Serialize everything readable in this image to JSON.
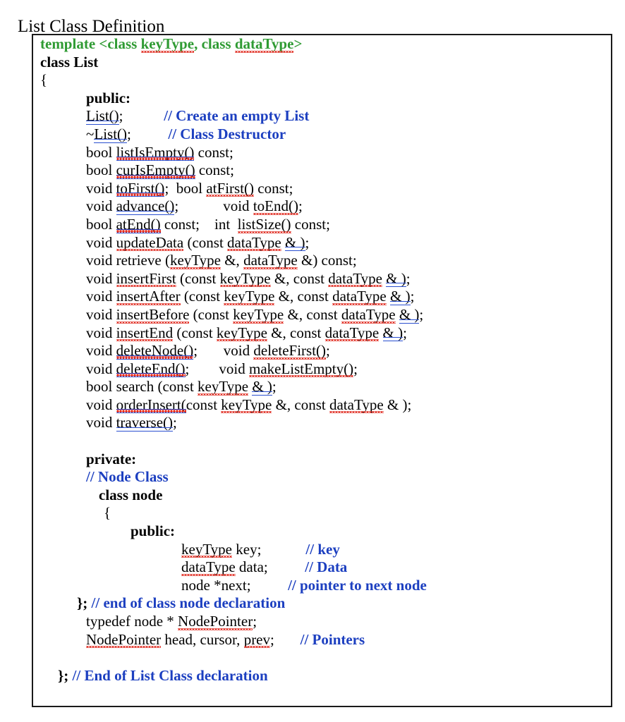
{
  "page": {
    "title": "List Class Definition",
    "colors": {
      "text": "#000000",
      "keyword_green": "#2f9b33",
      "comment_blue": "#1c3fc0",
      "spelling_squiggle_red": "#e02b20",
      "grammar_underline_blue": "#2a4fd0",
      "box_border": "#1a1a1a",
      "background": "#ffffff"
    }
  },
  "code": {
    "language": "C++",
    "lines": [
      {
        "indent": 10,
        "segs": [
          {
            "text": "template <class ",
            "style": "green"
          },
          {
            "text": "keyType",
            "style": "green",
            "mark": "spell"
          },
          {
            "text": ", class ",
            "style": "green"
          },
          {
            "text": "dataType",
            "style": "green",
            "mark": "spell"
          },
          {
            "text": ">",
            "style": "green"
          }
        ]
      },
      {
        "indent": 10,
        "segs": [
          {
            "text": "class List",
            "style": "bold"
          }
        ]
      },
      {
        "indent": 10,
        "segs": [
          {
            "text": "{",
            "style": "plain"
          }
        ]
      },
      {
        "indent": 75,
        "segs": [
          {
            "text": "public:",
            "style": "bold"
          }
        ]
      },
      {
        "indent": 75,
        "segs": [
          {
            "text": "List()",
            "style": "plain",
            "mark": "grammar"
          },
          {
            "text": ";",
            "style": "plain"
          },
          {
            "text": "           ",
            "style": "plain"
          },
          {
            "text": "// Create an empty List",
            "style": "comment"
          }
        ]
      },
      {
        "indent": 75,
        "segs": [
          {
            "text": "~",
            "style": "plain"
          },
          {
            "text": "List()",
            "style": "plain",
            "mark": "grammar"
          },
          {
            "text": ";",
            "style": "plain"
          },
          {
            "text": "          ",
            "style": "plain"
          },
          {
            "text": "// Class Destructor",
            "style": "comment"
          }
        ]
      },
      {
        "indent": 75,
        "segs": [
          {
            "text": "bool ",
            "style": "plain"
          },
          {
            "text": "listIsEmpty()",
            "style": "plain",
            "mark": "both"
          },
          {
            "text": " const;",
            "style": "plain"
          }
        ]
      },
      {
        "indent": 75,
        "segs": [
          {
            "text": "bool ",
            "style": "plain"
          },
          {
            "text": "curIsEmpty()",
            "style": "plain",
            "mark": "both"
          },
          {
            "text": " const;",
            "style": "plain"
          }
        ]
      },
      {
        "indent": 75,
        "segs": [
          {
            "text": "void ",
            "style": "plain"
          },
          {
            "text": "toFirst()",
            "style": "plain",
            "mark": "both"
          },
          {
            "text": ";  bool ",
            "style": "plain"
          },
          {
            "text": "atFirst()",
            "style": "plain",
            "mark": "spell"
          },
          {
            "text": " const;",
            "style": "plain"
          }
        ]
      },
      {
        "indent": 75,
        "segs": [
          {
            "text": "void ",
            "style": "plain"
          },
          {
            "text": "advance()",
            "style": "plain",
            "mark": "grammar"
          },
          {
            "text": ";",
            "style": "plain"
          },
          {
            "text": "            ",
            "style": "plain"
          },
          {
            "text": "void ",
            "style": "plain"
          },
          {
            "text": "toEnd()",
            "style": "plain",
            "mark": "spell"
          },
          {
            "text": ";",
            "style": "plain"
          }
        ]
      },
      {
        "indent": 75,
        "segs": [
          {
            "text": "bool ",
            "style": "plain"
          },
          {
            "text": "atEnd()",
            "style": "plain",
            "mark": "both"
          },
          {
            "text": " const;",
            "style": "plain"
          },
          {
            "text": "    int  ",
            "style": "plain"
          },
          {
            "text": "listSize()",
            "style": "plain",
            "mark": "spell"
          },
          {
            "text": " const;",
            "style": "plain"
          }
        ]
      },
      {
        "indent": 75,
        "segs": [
          {
            "text": "void ",
            "style": "plain"
          },
          {
            "text": "updateData",
            "style": "plain",
            "mark": "spell"
          },
          {
            "text": " (const ",
            "style": "plain"
          },
          {
            "text": "dataType",
            "style": "plain",
            "mark": "spell"
          },
          {
            "text": " ",
            "style": "plain"
          },
          {
            "text": "& )",
            "style": "plain",
            "mark": "grammar"
          },
          {
            "text": ";",
            "style": "plain"
          }
        ]
      },
      {
        "indent": 75,
        "segs": [
          {
            "text": "void retrieve (",
            "style": "plain"
          },
          {
            "text": "keyType",
            "style": "plain",
            "mark": "spell"
          },
          {
            "text": " &, ",
            "style": "plain"
          },
          {
            "text": "dataType",
            "style": "plain",
            "mark": "spell"
          },
          {
            "text": " &) const;",
            "style": "plain"
          }
        ]
      },
      {
        "indent": 75,
        "segs": [
          {
            "text": "void ",
            "style": "plain"
          },
          {
            "text": "insertFirst",
            "style": "plain",
            "mark": "spell"
          },
          {
            "text": " (const ",
            "style": "plain"
          },
          {
            "text": "keyType",
            "style": "plain",
            "mark": "spell"
          },
          {
            "text": " &, const ",
            "style": "plain"
          },
          {
            "text": "dataType",
            "style": "plain",
            "mark": "spell"
          },
          {
            "text": " ",
            "style": "plain"
          },
          {
            "text": "& )",
            "style": "plain",
            "mark": "grammar"
          },
          {
            "text": ";",
            "style": "plain"
          }
        ]
      },
      {
        "indent": 75,
        "segs": [
          {
            "text": "void ",
            "style": "plain"
          },
          {
            "text": "insertAfter",
            "style": "plain",
            "mark": "spell"
          },
          {
            "text": " (const ",
            "style": "plain"
          },
          {
            "text": "keyType",
            "style": "plain",
            "mark": "spell"
          },
          {
            "text": " &, const ",
            "style": "plain"
          },
          {
            "text": "dataType",
            "style": "plain",
            "mark": "spell"
          },
          {
            "text": " ",
            "style": "plain"
          },
          {
            "text": "& )",
            "style": "plain",
            "mark": "grammar"
          },
          {
            "text": ";",
            "style": "plain"
          }
        ]
      },
      {
        "indent": 75,
        "segs": [
          {
            "text": "void ",
            "style": "plain"
          },
          {
            "text": "insertBefore",
            "style": "plain",
            "mark": "spell"
          },
          {
            "text": " (const ",
            "style": "plain"
          },
          {
            "text": "keyType",
            "style": "plain",
            "mark": "spell"
          },
          {
            "text": " &, const ",
            "style": "plain"
          },
          {
            "text": "dataType",
            "style": "plain",
            "mark": "spell"
          },
          {
            "text": " ",
            "style": "plain"
          },
          {
            "text": "& )",
            "style": "plain",
            "mark": "grammar"
          },
          {
            "text": ";",
            "style": "plain"
          }
        ]
      },
      {
        "indent": 75,
        "segs": [
          {
            "text": "void ",
            "style": "plain"
          },
          {
            "text": "insertEnd",
            "style": "plain",
            "mark": "spell"
          },
          {
            "text": " (const ",
            "style": "plain"
          },
          {
            "text": "keyType",
            "style": "plain",
            "mark": "spell"
          },
          {
            "text": " &, const ",
            "style": "plain"
          },
          {
            "text": "dataType",
            "style": "plain",
            "mark": "spell"
          },
          {
            "text": " ",
            "style": "plain"
          },
          {
            "text": "& )",
            "style": "plain",
            "mark": "grammar"
          },
          {
            "text": ";",
            "style": "plain"
          }
        ]
      },
      {
        "indent": 75,
        "segs": [
          {
            "text": "void ",
            "style": "plain"
          },
          {
            "text": "deleteNode()",
            "style": "plain",
            "mark": "both"
          },
          {
            "text": ";",
            "style": "plain"
          },
          {
            "text": "       void ",
            "style": "plain"
          },
          {
            "text": "deleteFirst()",
            "style": "plain",
            "mark": "spell"
          },
          {
            "text": ";",
            "style": "plain"
          }
        ]
      },
      {
        "indent": 75,
        "segs": [
          {
            "text": "void ",
            "style": "plain"
          },
          {
            "text": "deleteEnd()",
            "style": "plain",
            "mark": "both"
          },
          {
            "text": ";",
            "style": "plain"
          },
          {
            "text": "        void ",
            "style": "plain"
          },
          {
            "text": "makeListEmpty()",
            "style": "plain",
            "mark": "spell"
          },
          {
            "text": ";",
            "style": "plain"
          }
        ]
      },
      {
        "indent": 75,
        "segs": [
          {
            "text": "bool search (const ",
            "style": "plain"
          },
          {
            "text": "keyType",
            "style": "plain",
            "mark": "spell"
          },
          {
            "text": " ",
            "style": "plain"
          },
          {
            "text": "& )",
            "style": "plain",
            "mark": "grammar"
          },
          {
            "text": ";",
            "style": "plain"
          }
        ]
      },
      {
        "indent": 75,
        "segs": [
          {
            "text": "void ",
            "style": "plain"
          },
          {
            "text": "orderInsert(",
            "style": "plain",
            "mark": "both"
          },
          {
            "text": "const ",
            "style": "plain"
          },
          {
            "text": "keyType",
            "style": "plain",
            "mark": "spell"
          },
          {
            "text": " &, const ",
            "style": "plain"
          },
          {
            "text": "dataType",
            "style": "plain",
            "mark": "spell"
          },
          {
            "text": " & );",
            "style": "plain"
          }
        ]
      },
      {
        "indent": 75,
        "segs": [
          {
            "text": "void ",
            "style": "plain"
          },
          {
            "text": "traverse()",
            "style": "plain",
            "mark": "grammar"
          },
          {
            "text": ";",
            "style": "plain"
          }
        ]
      },
      {
        "indent": 75,
        "segs": []
      },
      {
        "indent": 75,
        "segs": [
          {
            "text": "private:",
            "style": "bold"
          }
        ]
      },
      {
        "indent": 75,
        "segs": [
          {
            "text": "// Node Class",
            "style": "comment"
          }
        ]
      },
      {
        "indent": 93,
        "segs": [
          {
            "text": "class node",
            "style": "bold"
          }
        ]
      },
      {
        "indent": 100,
        "segs": [
          {
            "text": "{",
            "style": "plain"
          }
        ]
      },
      {
        "indent": 138,
        "segs": [
          {
            "text": "public:",
            "style": "bold"
          }
        ]
      },
      {
        "indent": 210,
        "segs": [
          {
            "text": "keyType",
            "style": "plain",
            "mark": "spell"
          },
          {
            "text": " key;",
            "style": "plain"
          },
          {
            "text": "            ",
            "style": "plain"
          },
          {
            "text": "// key",
            "style": "comment"
          }
        ]
      },
      {
        "indent": 210,
        "segs": [
          {
            "text": "dataType",
            "style": "plain",
            "mark": "spell"
          },
          {
            "text": " data;",
            "style": "plain"
          },
          {
            "text": "          ",
            "style": "plain"
          },
          {
            "text": "// Data",
            "style": "comment"
          }
        ]
      },
      {
        "indent": 210,
        "segs": [
          {
            "text": "node *next;",
            "style": "plain"
          },
          {
            "text": "          ",
            "style": "plain"
          },
          {
            "text": "// pointer to next node",
            "style": "comment"
          }
        ]
      },
      {
        "indent": 62,
        "segs": [
          {
            "text": "};",
            "style": "bold"
          },
          {
            "text": " ",
            "style": "plain"
          },
          {
            "text": "// end of class node declaration",
            "style": "comment"
          }
        ]
      },
      {
        "indent": 75,
        "segs": [
          {
            "text": "typedef node * ",
            "style": "plain"
          },
          {
            "text": "NodePointer",
            "style": "plain",
            "mark": "spell"
          },
          {
            "text": ";",
            "style": "plain"
          }
        ]
      },
      {
        "indent": 75,
        "segs": [
          {
            "text": "NodePointer",
            "style": "plain",
            "mark": "spell"
          },
          {
            "text": " head, cursor, ",
            "style": "plain"
          },
          {
            "text": "prev",
            "style": "plain",
            "mark": "spell"
          },
          {
            "text": ";",
            "style": "plain"
          },
          {
            "text": "       ",
            "style": "plain"
          },
          {
            "text": "// Pointers",
            "style": "comment"
          }
        ]
      },
      {
        "indent": 75,
        "segs": []
      },
      {
        "indent": 35,
        "segs": [
          {
            "text": "};",
            "style": "bold"
          },
          {
            "text": " ",
            "style": "plain"
          },
          {
            "text": "// End of List Class declaration",
            "style": "comment"
          }
        ]
      }
    ]
  }
}
